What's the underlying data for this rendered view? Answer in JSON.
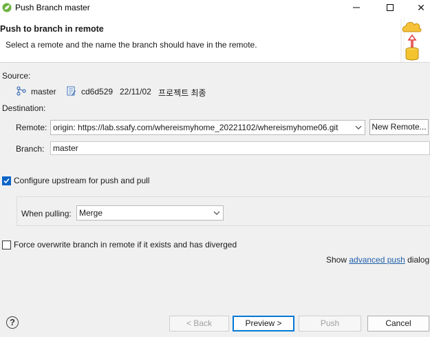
{
  "window": {
    "title": "Push Branch master",
    "close_glyph": "✕"
  },
  "header": {
    "title": "Push to branch in remote",
    "description": "Select a remote and the name the branch should have in the remote."
  },
  "source": {
    "label": "Source:",
    "branch": "master",
    "commit_hash": "cd6d529",
    "commit_date": "22/11/02",
    "commit_message": "프로젝트 최종"
  },
  "destination": {
    "label": "Destination:",
    "remote_label": "Remote:",
    "remote_value": "origin: https://lab.ssafy.com/whereismyhome_20221102/whereismyhome06.git",
    "new_remote_button": "New Remote...",
    "branch_label": "Branch:",
    "branch_value": "master"
  },
  "upstream": {
    "configure_label": "Configure upstream for push and pull",
    "configure_checked": true,
    "when_pulling_label": "When pulling:",
    "when_pulling_value": "Merge"
  },
  "force": {
    "label": "Force overwrite branch in remote if it exists and has diverged",
    "checked": false
  },
  "advanced": {
    "prefix": "Show ",
    "link": "advanced push",
    "suffix": " dialog"
  },
  "footer": {
    "help_glyph": "?",
    "back": "< Back",
    "preview": "Preview >",
    "push": "Push",
    "cancel": "Cancel"
  }
}
